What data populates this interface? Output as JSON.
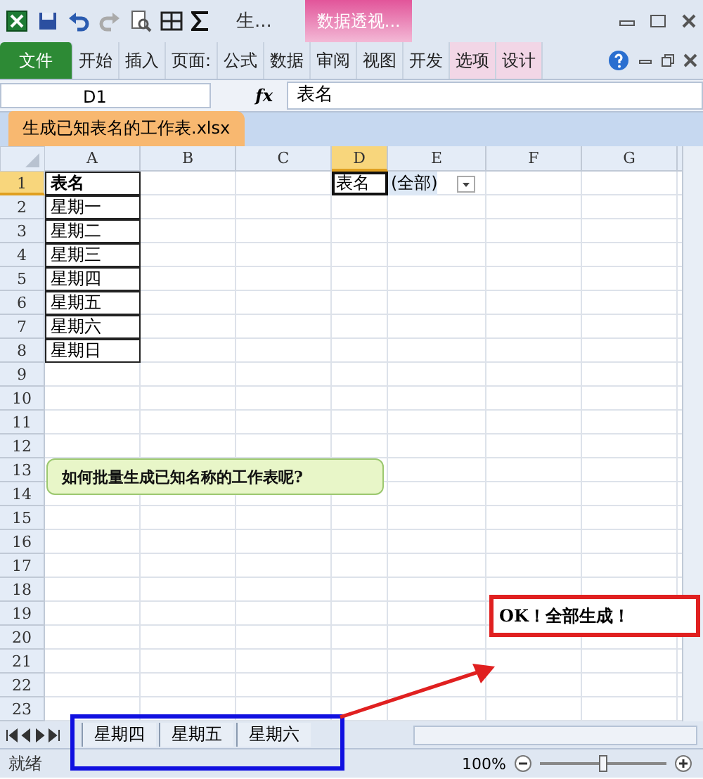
{
  "title_bar": {
    "document_title": "生...",
    "context_group": "数据透视..."
  },
  "ribbon_tabs": [
    {
      "label": "文件",
      "kind": "file"
    },
    {
      "label": "开始",
      "kind": "normal"
    },
    {
      "label": "插入",
      "kind": "normal"
    },
    {
      "label": "页面:",
      "kind": "normal"
    },
    {
      "label": "公式",
      "kind": "normal"
    },
    {
      "label": "数据",
      "kind": "normal"
    },
    {
      "label": "审阅",
      "kind": "normal"
    },
    {
      "label": "视图",
      "kind": "normal"
    },
    {
      "label": "开发",
      "kind": "normal"
    },
    {
      "label": "选项",
      "kind": "context"
    },
    {
      "label": "设计",
      "kind": "context"
    }
  ],
  "formula_bar": {
    "name_box": "D1",
    "fx": "fx",
    "value": "表名"
  },
  "workbook_tab": "生成已知表名的工作表.xlsx",
  "columns": [
    {
      "label": "A",
      "selected": false
    },
    {
      "label": "B",
      "selected": false
    },
    {
      "label": "C",
      "selected": false
    },
    {
      "label": "D",
      "selected": true
    },
    {
      "label": "E",
      "selected": false
    },
    {
      "label": "F",
      "selected": false
    },
    {
      "label": "G",
      "selected": false
    }
  ],
  "rows": [
    {
      "number": "1",
      "selected": true,
      "a": "表名",
      "bold": true
    },
    {
      "number": "2",
      "selected": false,
      "a": "星期一"
    },
    {
      "number": "3",
      "selected": false,
      "a": "星期二"
    },
    {
      "number": "4",
      "selected": false,
      "a": "星期三"
    },
    {
      "number": "5",
      "selected": false,
      "a": "星期四"
    },
    {
      "number": "6",
      "selected": false,
      "a": "星期五"
    },
    {
      "number": "7",
      "selected": false,
      "a": "星期六"
    },
    {
      "number": "8",
      "selected": false,
      "a": "星期日"
    },
    {
      "number": "9",
      "selected": false
    },
    {
      "number": "10",
      "selected": false
    },
    {
      "number": "11",
      "selected": false
    },
    {
      "number": "12",
      "selected": false
    },
    {
      "number": "13",
      "selected": false
    },
    {
      "number": "14",
      "selected": false
    },
    {
      "number": "15",
      "selected": false
    },
    {
      "number": "16",
      "selected": false
    },
    {
      "number": "17",
      "selected": false
    },
    {
      "number": "18",
      "selected": false
    },
    {
      "number": "19",
      "selected": false
    },
    {
      "number": "20",
      "selected": false
    },
    {
      "number": "21",
      "selected": false
    },
    {
      "number": "22",
      "selected": false
    },
    {
      "number": "23",
      "selected": false
    }
  ],
  "pivot_filter": {
    "field": "表名",
    "value": "(全部)"
  },
  "sheet_tabs": [
    {
      "label": "星期四"
    },
    {
      "label": "星期五"
    },
    {
      "label": "星期六"
    }
  ],
  "status_bar": {
    "status": "就绪",
    "zoom": "100%",
    "zoom_slider": {
      "level": 0.5
    }
  },
  "annotations": [
    {
      "kind": "callout",
      "text": "如何批量生成已知名称的工作表呢?"
    },
    {
      "kind": "result",
      "text": "OK！全部生成！"
    }
  ]
}
